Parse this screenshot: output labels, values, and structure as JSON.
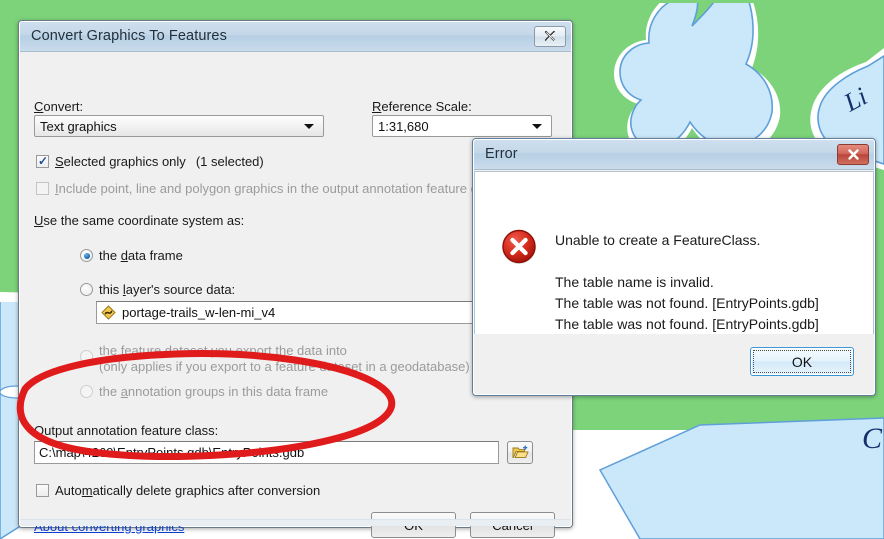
{
  "map": {
    "label_1": "Li",
    "label_2": "C",
    "land_color": "#7cd37a",
    "water_color": "#cbe8fa",
    "water_outline": "#5f9fd8",
    "shore_color": "#ffffff",
    "blank_color": "#ffffff"
  },
  "annotation": {
    "name": "red-ellipse-highlight",
    "color": "#e01b1b"
  },
  "convert_dialog": {
    "title": "Convert Graphics To Features",
    "close_icon": "close-icon",
    "convert_label": "Convert:",
    "convert_value": "Text graphics",
    "reference_scale_label": "Reference Scale:",
    "reference_scale_value": "1:31,680",
    "selected_only_label": "Selected graphics only",
    "selected_only_count": "(1 selected)",
    "selected_only_checked": true,
    "include_graphics_label": "Include point, line and polygon graphics in the output annotation feature c",
    "include_graphics_checked": false,
    "coord_system_label": "Use the same coordinate system as:",
    "radios": [
      {
        "label": "the data frame",
        "checked": true,
        "disabled": false
      },
      {
        "label": "this layer's source data:",
        "checked": false,
        "disabled": false
      },
      {
        "label": "the feature dataset you export the data into",
        "label2": "(only applies if you export to a feature dataset in a geodatabase)",
        "checked": false,
        "disabled": true
      },
      {
        "label": "the annotation groups in this data frame",
        "checked": false,
        "disabled": true
      }
    ],
    "layer_value": "portage-trails_w-len-mi_v4",
    "layer_icon": "layer-diamond-icon",
    "output_label": "Output annotation feature class:",
    "output_value": "C:\\map\\4269\\EntryPoints.gdb\\EntryPoints.gdb",
    "browse_icon": "open-folder-icon",
    "auto_delete_label": "Automatically delete graphics after conversion",
    "auto_delete_checked": false,
    "about_link": "About converting graphics",
    "ok_label": "OK",
    "cancel_label": "Cancel"
  },
  "error_dialog": {
    "title": "Error",
    "close_icon": "close-icon",
    "error_icon": "error-circle-icon",
    "lines": [
      "Unable to create a FeatureClass.",
      "",
      "The table name is invalid.",
      "The table was not found. [EntryPoints.gdb]",
      "The table was not found. [EntryPoints.gdb]"
    ],
    "ok_label": "OK"
  }
}
